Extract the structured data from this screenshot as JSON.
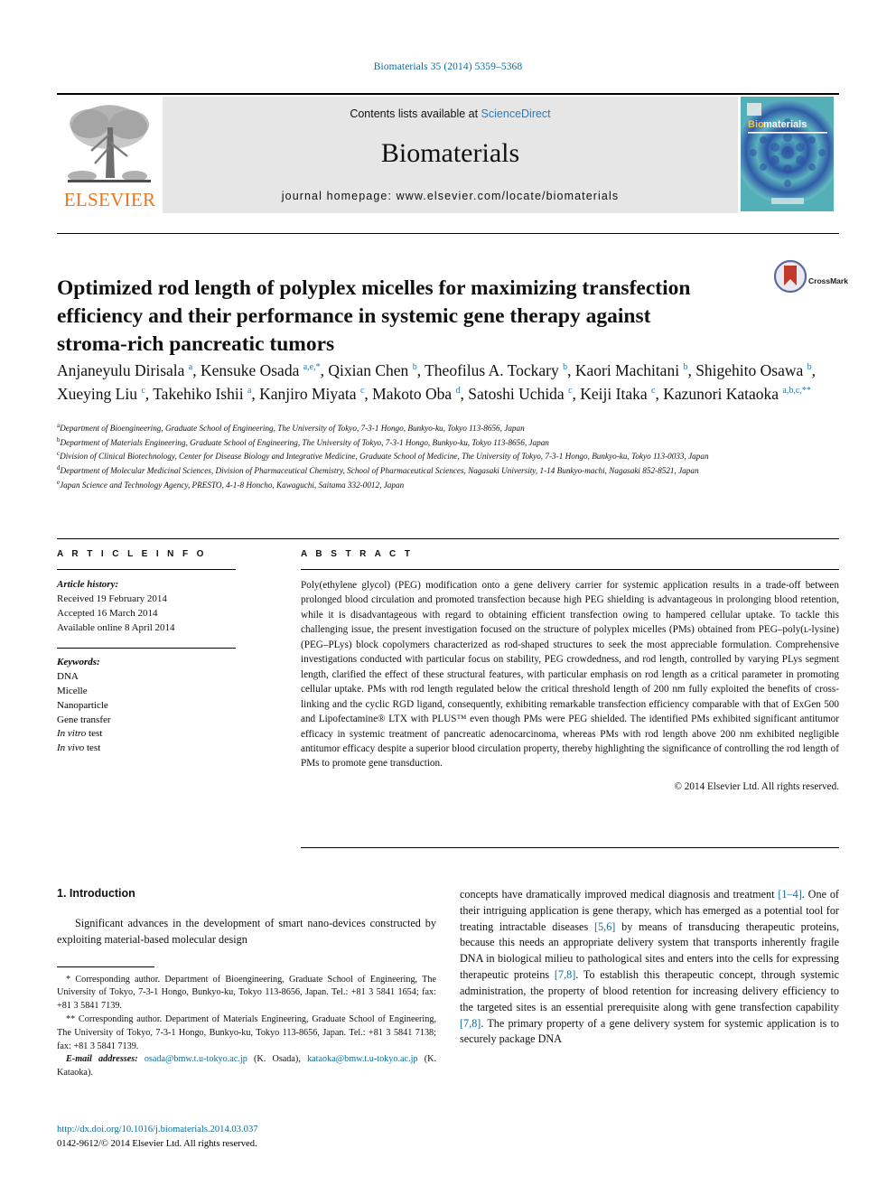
{
  "running_head": "Biomaterials 35 (2014) 5359–5368",
  "masthead": {
    "contents_prefix": "Contents lists available at ",
    "sciencedirect": "ScienceDirect",
    "journal_name": "Biomaterials",
    "homepage": "journal homepage: www.elsevier.com/locate/biomaterials",
    "publisher_wordmark": "ELSEVIER",
    "cover_title_a": "Bio",
    "cover_title_b": "materials",
    "accent_orange": "#e87722",
    "accent_blue": "#2b7bb9"
  },
  "crossmark": {
    "label": "CrossMark"
  },
  "article": {
    "title": "Optimized rod length of polyplex micelles for maximizing transfection efficiency and their performance in systemic gene therapy against stroma-rich pancreatic tumors",
    "authors_html": "Anjaneyulu Dirisala <sup>a</sup>, Kensuke Osada <sup>a,e,*</sup>, Qixian Chen <sup>b</sup>, Theofilus A. Tockary <sup>b</sup>, Kaori Machitani <sup>b</sup>, Shigehito Osawa <sup>b</sup>, Xueying Liu <sup>c</sup>, Takehiko Ishii <sup>a</sup>, Kanjiro Miyata <sup>c</sup>, Makoto Oba <sup>d</sup>, Satoshi Uchida <sup>c</sup>, Keiji Itaka <sup>c</sup>, Kazunori Kataoka <sup>a,b,c,**</sup>",
    "affiliations": [
      "a Department of Bioengineering, Graduate School of Engineering, The University of Tokyo, 7-3-1 Hongo, Bunkyo-ku, Tokyo 113-8656, Japan",
      "b Department of Materials Engineering, Graduate School of Engineering, The University of Tokyo, 7-3-1 Hongo, Bunkyo-ku, Tokyo 113-8656, Japan",
      "c Division of Clinical Biotechnology, Center for Disease Biology and Integrative Medicine, Graduate School of Medicine, The University of Tokyo, 7-3-1 Hongo, Bunkyo-ku, Tokyo 113-0033, Japan",
      "d Department of Molecular Medicinal Sciences, Division of Pharmaceutical Chemistry, School of Pharmaceutical Sciences, Nagasaki University, 1-14 Bunkyo-machi, Nagasaki 852-8521, Japan",
      "e Japan Science and Technology Agency, PRESTO, 4-1-8 Honcho, Kawaguchi, Saitama 332-0012, Japan"
    ]
  },
  "article_info": {
    "heading": "A R T I C L E  I N F O",
    "history_label": "Article history:",
    "history": [
      "Received 19 February 2014",
      "Accepted 16 March 2014",
      "Available online 8 April 2014"
    ],
    "keywords_label": "Keywords:",
    "keywords": [
      "DNA",
      "Micelle",
      "Nanoparticle",
      "Gene transfer",
      "In vitro test",
      "In vivo test"
    ]
  },
  "abstract": {
    "heading": "A B S T R A C T",
    "text": "Poly(ethylene glycol) (PEG) modification onto a gene delivery carrier for systemic application results in a trade-off between prolonged blood circulation and promoted transfection because high PEG shielding is advantageous in prolonging blood retention, while it is disadvantageous with regard to obtaining efficient transfection owing to hampered cellular uptake. To tackle this challenging issue, the present investigation focused on the structure of polyplex micelles (PMs) obtained from PEG–poly(ʟ-lysine) (PEG–PLys) block copolymers characterized as rod-shaped structures to seek the most appreciable formulation. Comprehensive investigations conducted with particular focus on stability, PEG crowdedness, and rod length, controlled by varying PLys segment length, clarified the effect of these structural features, with particular emphasis on rod length as a critical parameter in promoting cellular uptake. PMs with rod length regulated below the critical threshold length of 200 nm fully exploited the benefits of cross-linking and the cyclic RGD ligand, consequently, exhibiting remarkable transfection efficiency comparable with that of ExGen 500 and Lipofectamine® LTX with PLUS™ even though PMs were PEG shielded. The identified PMs exhibited significant antitumor efficacy in systemic treatment of pancreatic adenocarcinoma, whereas PMs with rod length above 200 nm exhibited negligible antitumor efficacy despite a superior blood circulation property, thereby highlighting the significance of controlling the rod length of PMs to promote gene transduction.",
    "copyright": "© 2014 Elsevier Ltd. All rights reserved."
  },
  "introduction": {
    "heading": "1.  Introduction",
    "left_paragraph": "Significant advances in the development of smart nano-devices constructed by exploiting material-based molecular design",
    "right_part1": "concepts have dramatically improved medical diagnosis and treatment ",
    "right_ref1": "[1–4]",
    "right_part2": ". One of their intriguing application is gene therapy, which has emerged as a potential tool for treating intractable diseases ",
    "right_ref2": "[5,6]",
    "right_part3": " by means of transducing therapeutic proteins, because this needs an appropriate delivery system that transports inherently fragile DNA in biological milieu to pathological sites and enters into the cells for expressing therapeutic proteins ",
    "right_ref3": "[7,8]",
    "right_part4": ". To establish this therapeutic concept, through systemic administration, the property of blood retention for increasing delivery efficiency to the targeted sites is an essential prerequisite along with gene transfection capability ",
    "right_ref4": "[7,8]",
    "right_part5": ". The primary property of a gene delivery system for systemic application is to securely package DNA"
  },
  "footnotes": {
    "corresponding_1": "* Corresponding author. Department of Bioengineering, Graduate School of Engineering, The University of Tokyo, 7-3-1 Hongo, Bunkyo-ku, Tokyo 113-8656, Japan. Tel.: +81 3 5841 1654; fax: +81 3 5841 7139.",
    "corresponding_2": "** Corresponding author. Department of Materials Engineering, Graduate School of Engineering, The University of Tokyo, 7-3-1 Hongo, Bunkyo-ku, Tokyo 113-8656, Japan. Tel.: +81 3 5841 7138; fax: +81 3 5841 7139.",
    "email_label": "E-mail addresses:",
    "email_1": "osada@bmw.t.u-tokyo.ac.jp",
    "email_1_owner": "(K. Osada),",
    "email_2": "kataoka@bmw.t.u-tokyo.ac.jp",
    "email_2_owner": "(K. Kataoka)."
  },
  "doi_block": {
    "doi": "http://dx.doi.org/10.1016/j.biomaterials.2014.03.037",
    "issn_line": "0142-9612/© 2014 Elsevier Ltd. All rights reserved."
  }
}
